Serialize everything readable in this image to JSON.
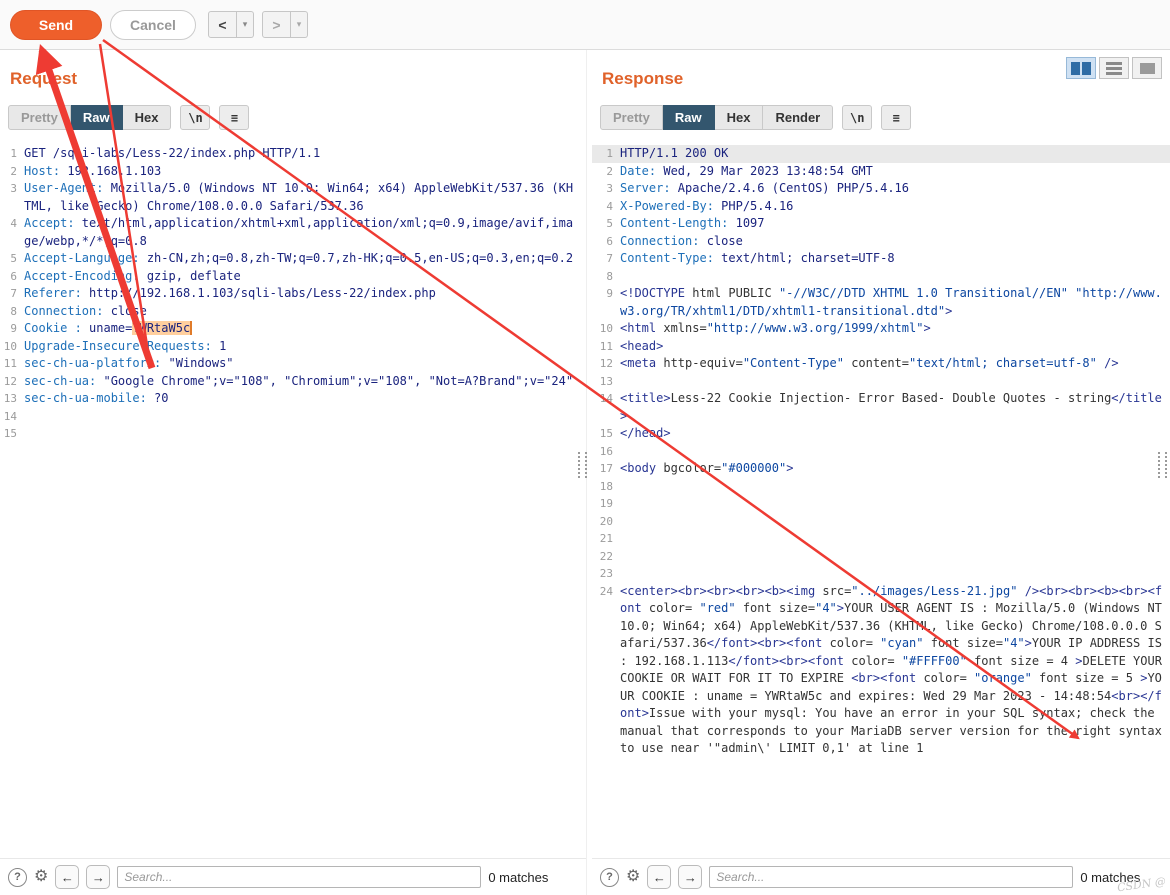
{
  "toolbar": {
    "send_label": "Send",
    "cancel_label": "Cancel",
    "back_label": "<",
    "forward_label": ">"
  },
  "icons": {
    "dropdown": "▾",
    "menu": "≡",
    "help": "?",
    "settings": "⚙",
    "prev": "←",
    "next": "→"
  },
  "request": {
    "title": "Request",
    "tabs": [
      "Pretty",
      "Raw",
      "Hex"
    ],
    "active_tab": "Raw",
    "newline_button": "\\n",
    "cookie_highlight": "YWRtaW5c",
    "search": {
      "placeholder": "Search...",
      "matches": "0 matches"
    },
    "lines": [
      "GET /sqli-labs/Less-22/index.php HTTP/1.1",
      "Host: 192.168.1.103",
      "User-Agent: Mozilla/5.0 (Windows NT 10.0; Win64; x64) AppleWebKit/537.36 (KHTML, like Gecko) Chrome/108.0.0.0 Safari/537.36",
      "Accept: text/html,application/xhtml+xml,application/xml;q=0.9,image/avif,image/webp,*/*;q=0.8",
      "Accept-Language: zh-CN,zh;q=0.8,zh-TW;q=0.7,zh-HK;q=0.5,en-US;q=0.3,en;q=0.2",
      "Accept-Encoding: gzip, deflate",
      "Referer: http://192.168.1.103/sqli-labs/Less-22/index.php",
      "Connection: close",
      "Cookie : uname=YWRtaW5c",
      "Upgrade-Insecure-Requests: 1",
      "sec-ch-ua-platform: \"Windows\"",
      "sec-ch-ua: \"Google Chrome\";v=\"108\", \"Chromium\";v=\"108\", \"Not=A?Brand\";v=\"24\"",
      "sec-ch-ua-mobile: ?0",
      "",
      ""
    ]
  },
  "response": {
    "title": "Response",
    "tabs": [
      "Pretty",
      "Raw",
      "Hex",
      "Render"
    ],
    "active_tab": "Raw",
    "newline_button": "\\n",
    "selected_line": 1,
    "search": {
      "placeholder": "Search...",
      "matches": "0 matches"
    },
    "lines": [
      "HTTP/1.1 200 OK",
      "Date: Wed, 29 Mar 2023 13:48:54 GMT",
      "Server: Apache/2.4.6 (CentOS) PHP/5.4.16",
      "X-Powered-By: PHP/5.4.16",
      "Content-Length: 1097",
      "Connection: close",
      "Content-Type: text/html; charset=UTF-8",
      "",
      "<!DOCTYPE html PUBLIC \"-//W3C//DTD XHTML 1.0 Transitional//EN\" \"http://www.w3.org/TR/xhtml1/DTD/xhtml1-transitional.dtd\">",
      "<html xmlns=\"http://www.w3.org/1999/xhtml\">",
      "<head>",
      "<meta http-equiv=\"Content-Type\" content=\"text/html; charset=utf-8\" />",
      "",
      "<title>Less-22 Cookie Injection- Error Based- Double Quotes - string</title>",
      "</head>",
      "",
      "<body bgcolor=\"#000000\">",
      "",
      "",
      "",
      "",
      "",
      "",
      "<center><br><br><br><b><img src=\"../images/Less-21.jpg\" /><br><br><b><br><font color= \"red\" font size=\"4\">YOUR USER AGENT IS : Mozilla/5.0 (Windows NT 10.0; Win64; x64) AppleWebKit/537.36 (KHTML, like Gecko) Chrome/108.0.0.0 Safari/537.36</font><br><font color= \"cyan\" font size=\"4\">YOUR IP ADDRESS IS : 192.168.1.113</font><br><font color= \"#FFFF00\" font size = 4 >DELETE YOUR COOKIE OR WAIT FOR IT TO EXPIRE <br><font color= \"orange\" font size = 5 >YOUR COOKIE : uname = YWRtaW5c and expires: Wed 29 Mar 2023 - 14:48:54<br></font>Issue with your mysql: You have an error in your SQL syntax; check the manual that corresponds to your MariaDB server version for the right syntax to use near '\"admin\\' LIMIT 0,1' at line 1"
    ]
  },
  "watermark": "CSDN @",
  "colors": {
    "accent_orange": "#e0622a",
    "send_button": "#ee5f2b",
    "tab_active": "#33566e",
    "highlight_bg": "#ffcf9e",
    "arrow_red": "#ee3b33"
  }
}
